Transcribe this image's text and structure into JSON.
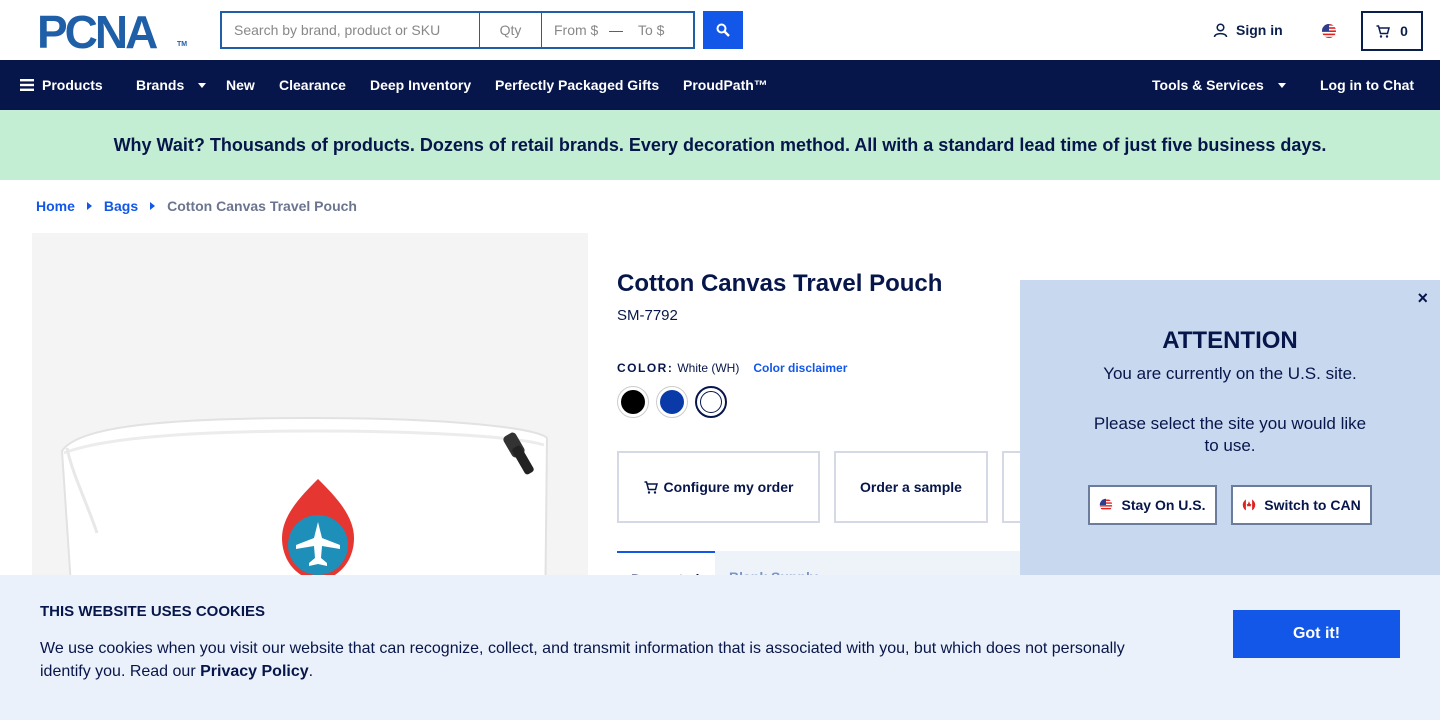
{
  "header": {
    "logo_text": "PCNA",
    "logo_tm": "TM",
    "search": {
      "placeholder": "Search by brand, product or SKU",
      "qty_placeholder": "Qty",
      "from_placeholder": "From $",
      "dash": "—",
      "to_placeholder": "To $"
    },
    "signin_label": "Sign in",
    "cart_count": "0"
  },
  "nav": {
    "products": "Products",
    "brands": "Brands",
    "new": "New",
    "clearance": "Clearance",
    "deep_inventory": "Deep Inventory",
    "gifts": "Perfectly Packaged Gifts",
    "proudpath": "ProudPath™",
    "tools": "Tools & Services",
    "chat": "Log in to Chat"
  },
  "banner": {
    "text": "Why Wait? Thousands of products. Dozens of retail brands. Every decoration method. All with a standard lead time of just five business days."
  },
  "breadcrumb": {
    "home": "Home",
    "bags": "Bags",
    "current": "Cotton Canvas Travel Pouch"
  },
  "product": {
    "title": "Cotton Canvas Travel Pouch",
    "sku": "SM-7792",
    "color_label": "COLOR:",
    "color_value": "White (WH)",
    "color_disclaimer": "Color disclaimer",
    "swatches": [
      {
        "name": "Black",
        "color": "#000000"
      },
      {
        "name": "Royal Blue",
        "color": "#0a3aa8"
      },
      {
        "name": "White",
        "color": "#ffffff"
      }
    ],
    "configure_label": "Configure my order",
    "sample_label": "Order a sample",
    "tab_active": "Decorated",
    "tab_2": "Blank     Supply"
  },
  "attention": {
    "close": "×",
    "title": "ATTENTION",
    "line1": "You are currently on the U.S. site.",
    "line2": "Please select the site you would like to use.",
    "stay_label": "Stay On U.S.",
    "switch_label": "Switch to CAN"
  },
  "cookie": {
    "title": "THIS WEBSITE USES COOKIES",
    "text": "We use cookies when you visit our website that can recognize, collect, and transmit information that is associated with you, but which does not personally identify you. Read our",
    "link": "Privacy Policy",
    "period": ".",
    "button": "Got it!"
  },
  "colors": {
    "navy": "#07164a",
    "brand_blue": "#1357e8",
    "banner_green": "#c3eed3",
    "modal_blue": "#c8d8ef",
    "cookie_bg": "#ebf1fa"
  }
}
